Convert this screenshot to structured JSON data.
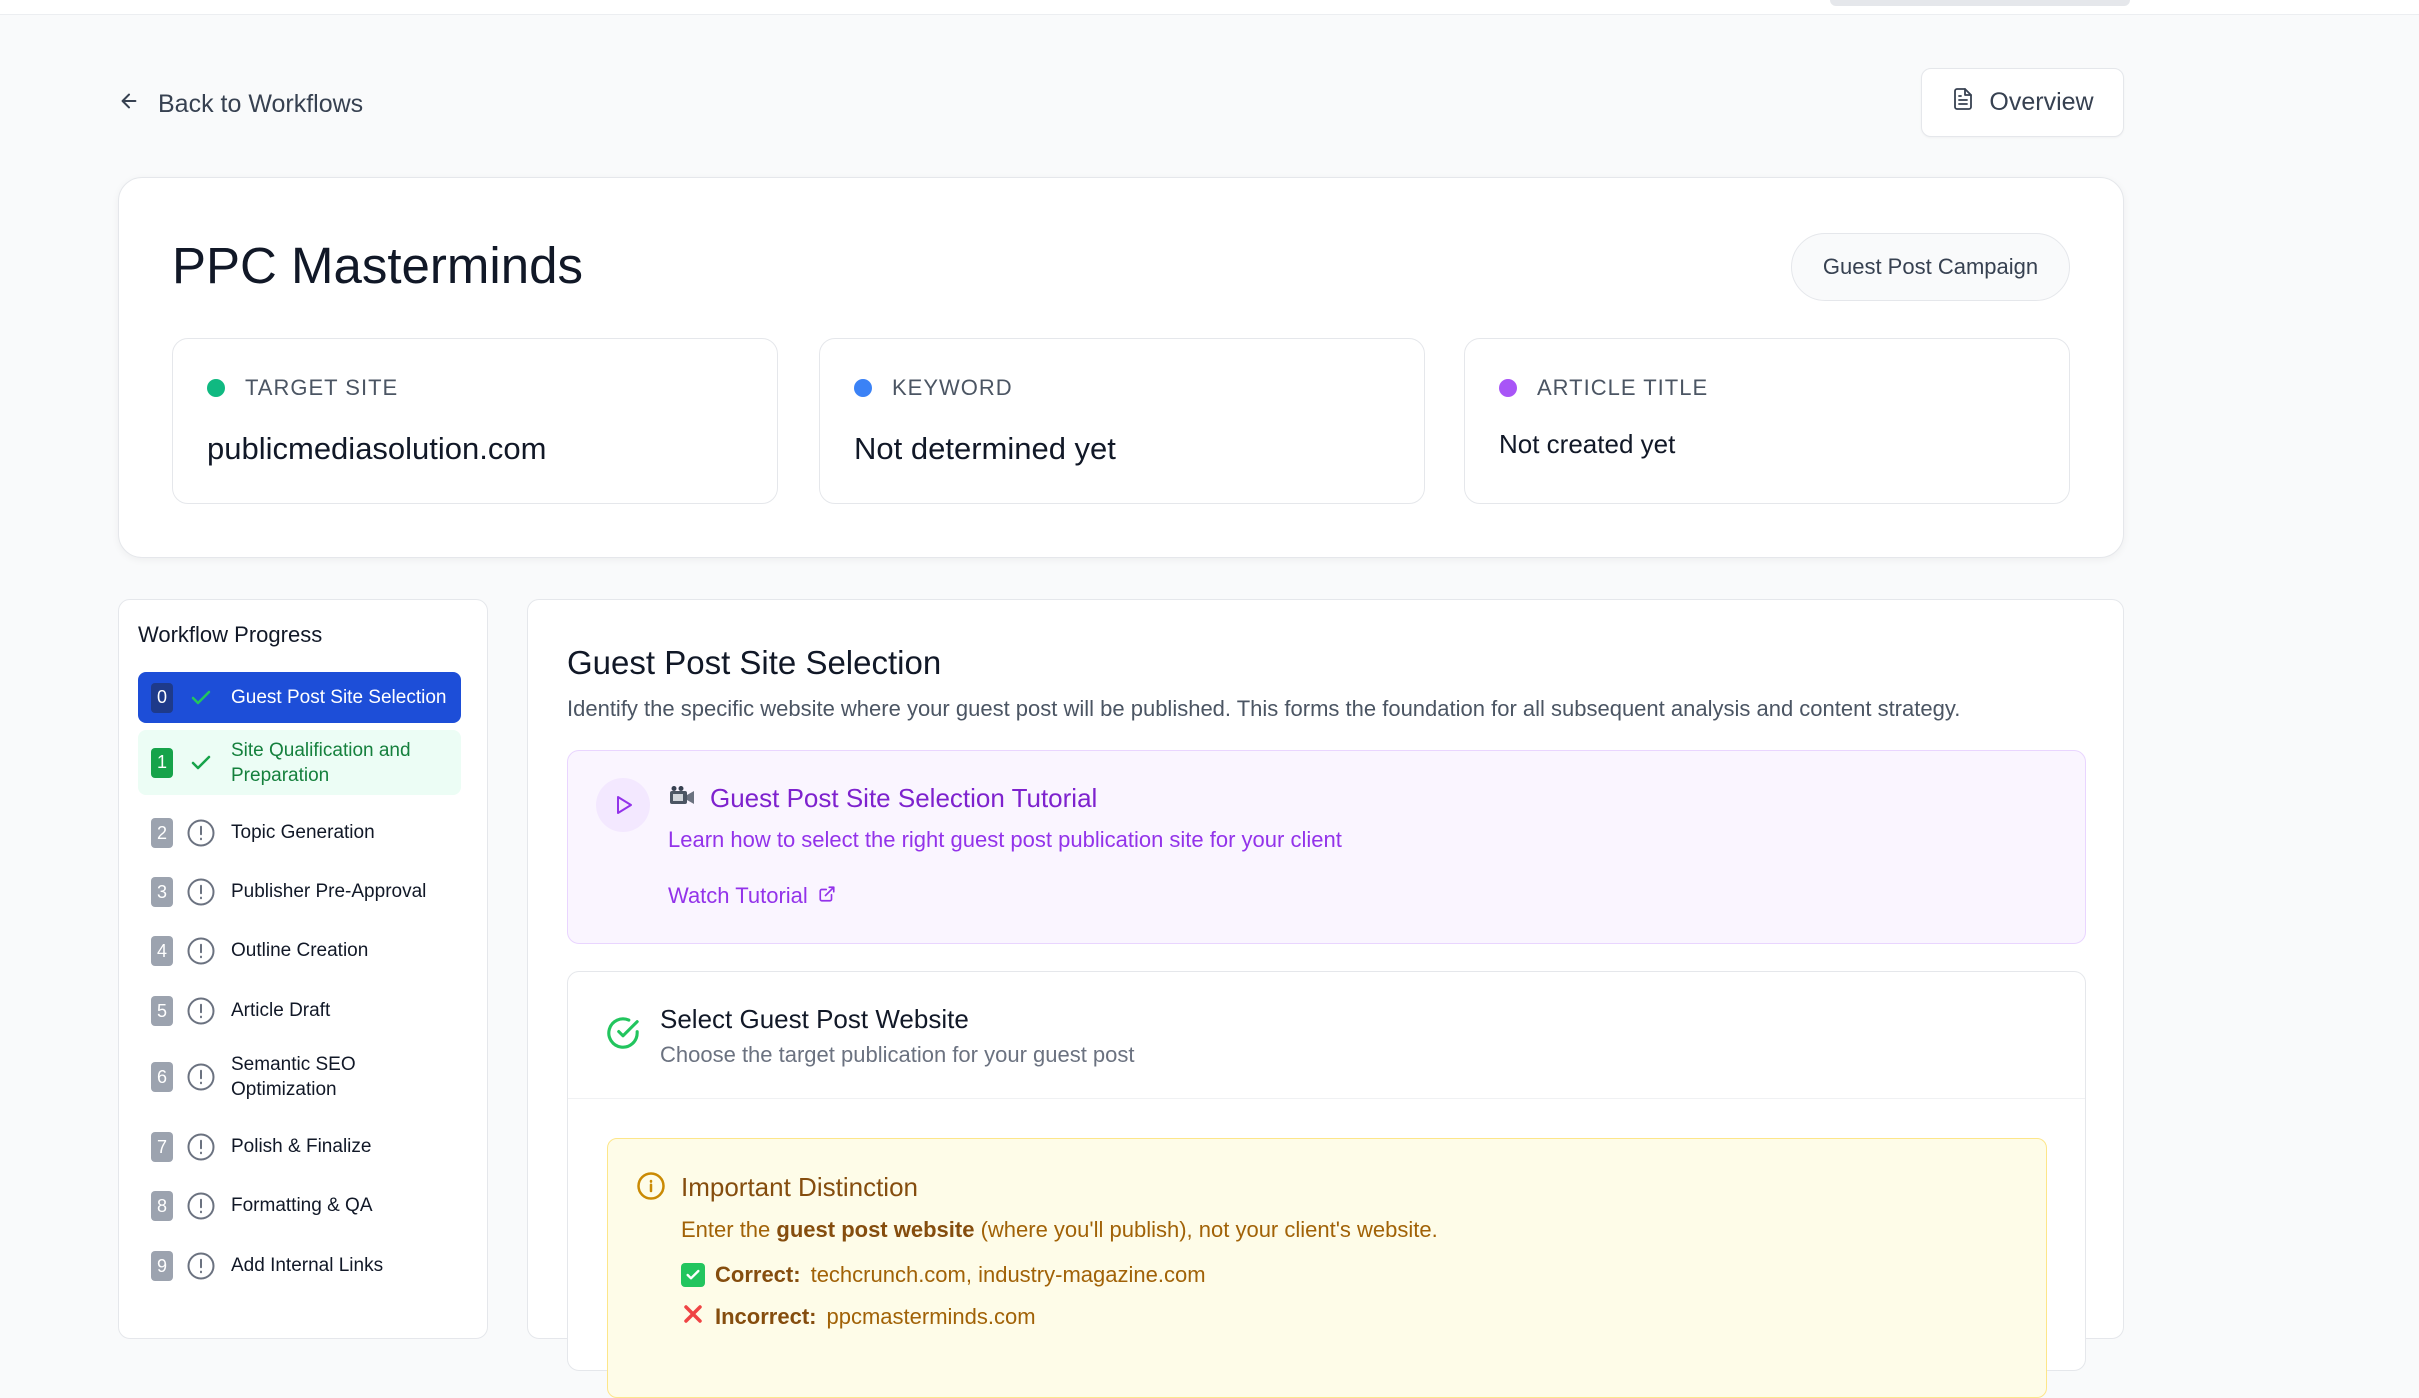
{
  "nav": {
    "back_label": "Back to Workflows",
    "overview_label": "Overview"
  },
  "header": {
    "client_name": "PPC Masterminds",
    "campaign_type": "Guest Post Campaign",
    "cards": [
      {
        "label": "TARGET SITE",
        "value": "publicmediasolution.com",
        "dot_color": "#10b981"
      },
      {
        "label": "KEYWORD",
        "value": "Not determined yet",
        "dot_color": "#3b82f6"
      },
      {
        "label": "ARTICLE TITLE",
        "value": "Not created yet",
        "dot_color": "#a855f7"
      }
    ]
  },
  "sidebar": {
    "title": "Workflow Progress",
    "steps": [
      {
        "num": "0",
        "label": "Guest Post Site Selection",
        "state": "active"
      },
      {
        "num": "1",
        "label": "Site Qualification and",
        "label2": "Preparation",
        "state": "done"
      },
      {
        "num": "2",
        "label": "Topic Generation",
        "state": "pending"
      },
      {
        "num": "3",
        "label": "Publisher Pre-Approval",
        "state": "pending"
      },
      {
        "num": "4",
        "label": "Outline Creation",
        "state": "pending"
      },
      {
        "num": "5",
        "label": "Article Draft",
        "state": "pending"
      },
      {
        "num": "6",
        "label": "Semantic SEO",
        "label2": "Optimization",
        "state": "pending"
      },
      {
        "num": "7",
        "label": "Polish & Finalize",
        "state": "pending"
      },
      {
        "num": "8",
        "label": "Formatting & QA",
        "state": "pending"
      },
      {
        "num": "9",
        "label": "Add Internal Links",
        "state": "pending"
      }
    ]
  },
  "main": {
    "title": "Guest Post Site Selection",
    "description": "Identify the specific website where your guest post will be published. This forms the foundation for all subsequent analysis and content strategy.",
    "tutorial": {
      "title": "Guest Post Site Selection Tutorial",
      "description": "Learn how to select the right guest post publication site for your client",
      "link_label": "Watch Tutorial"
    },
    "select_card": {
      "title": "Select Guest Post Website",
      "description": "Choose the target publication for your guest post"
    },
    "distinction": {
      "title": "Important Distinction",
      "text_prefix": "Enter the",
      "text_bold": "guest post website",
      "text_suffix": "(where you'll publish), not your client's website.",
      "correct_label": "Correct:",
      "correct_value": "techcrunch.com, industry-magazine.com",
      "incorrect_label": "Incorrect:",
      "incorrect_value": "ppcmasterminds.com"
    }
  },
  "colors": {
    "accent": "#1d4ed8",
    "success": "#16a34a",
    "tutorial": "#9333ea",
    "warning": "#a16207"
  }
}
